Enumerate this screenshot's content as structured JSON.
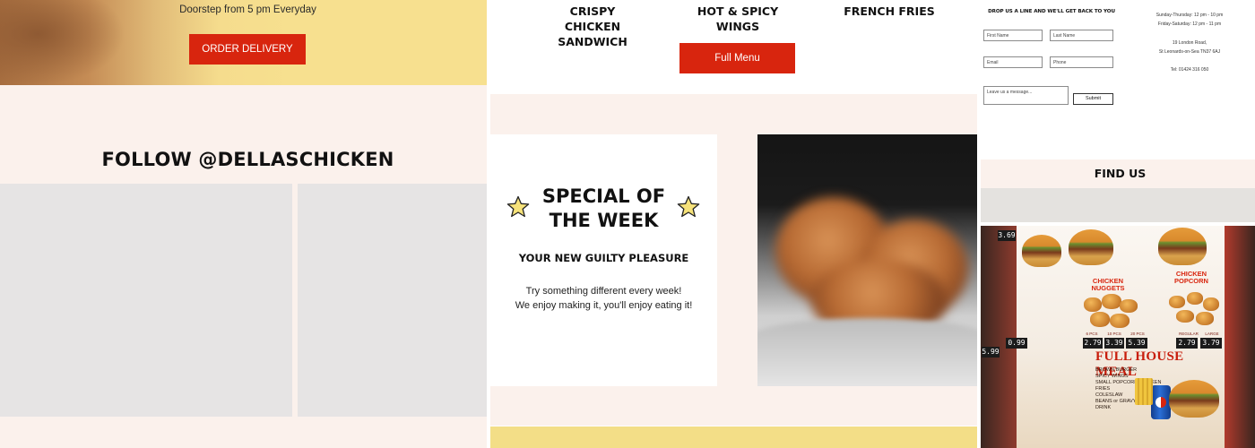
{
  "panel1": {
    "hero_subtitle": "Doorstep from 5 pm Everyday",
    "order_button": "ORDER DELIVERY",
    "follow_title": "FOLLOW @DELLASCHICKEN"
  },
  "panel2": {
    "menu_items": [
      "CRISPY CHICKEN SANDWICH",
      "HOT & SPICY WINGS",
      "FRENCH FRIES"
    ],
    "full_menu_button": "Full Menu",
    "special_title": "SPECIAL OF THE WEEK",
    "special_subtitle": "YOUR NEW GUILTY PLEASURE",
    "special_desc_line1": "Try something different every week!",
    "special_desc_line2": "We enjoy making it, you'll enjoy eating it!",
    "icons": {
      "left": "star-icon",
      "right": "star-icon"
    }
  },
  "panel3": {
    "contact_heading": "DROP US A LINE AND WE'LL GET BACK TO YOU",
    "fields": {
      "first_name": "First Name",
      "last_name": "Last Name",
      "email": "Email",
      "phone": "Phone",
      "message": "Leave us a message..."
    },
    "submit_label": "Submit",
    "hours_line1": "Sunday-Thursday: 12 pm - 10 pm",
    "hours_line2": "Friday-Saturday: 12 pm - 11 pm",
    "address_line1": "19 London Road,",
    "address_line2": "St Leonards-on-Sea TN37 6AJ",
    "tel": "Tel: 01424 316 050",
    "find_us": "FIND US"
  },
  "store_board": {
    "nuggets_label": "CHICKEN NUGGETS",
    "popcorn_label": "CHICKEN POPCORN",
    "meal_heading": "FULL HOUSE MEAL",
    "meal_items": "BROWN BURGER\nSPICY WINGS\nSMALL POPCORN CHICKEN\nFRIES\nCOLESLAW\nBEANS or GRAVY\nDRINK",
    "prices_top": [
      "2.79",
      "3.39",
      "5.39"
    ],
    "prices_popcorn": [
      "2.79",
      "3.79"
    ],
    "price_left": "0.99",
    "price_edge": "5.99",
    "price_top": "3.69",
    "tiny_sizes": [
      "6 PCS",
      "10 PCS",
      "20 PCS"
    ],
    "tiny_popcorn": [
      "REGULAR",
      "LARGE"
    ]
  },
  "colors": {
    "accent_red": "#d8250e",
    "cream": "#fbf1ec",
    "yellow": "#f7e08f",
    "placeholder_gray": "#e6e4e4"
  }
}
